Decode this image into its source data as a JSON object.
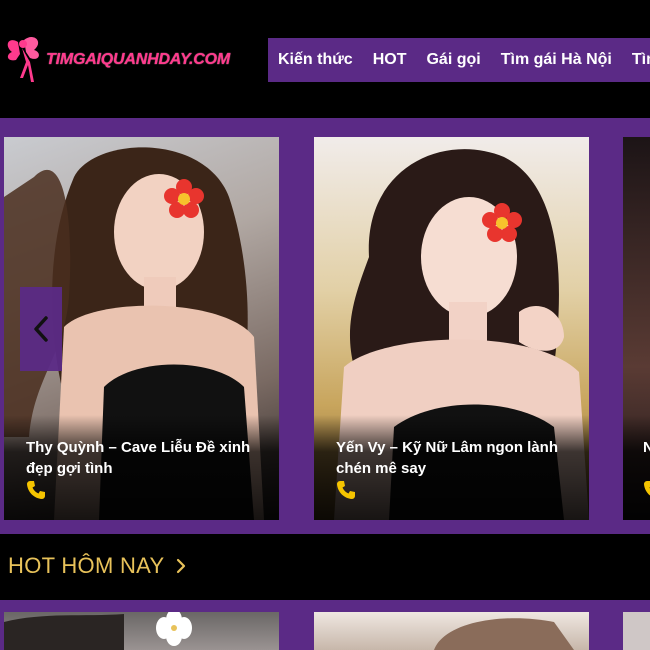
{
  "site": {
    "logo_text": "TIMGAIQUANHDAY.COM",
    "brand_pink": "#ff3a8d",
    "accent_purple": "#5b2a86",
    "heading_gold": "#e8c25a"
  },
  "nav": {
    "items": [
      {
        "label": "Kiến thức"
      },
      {
        "label": "HOT"
      },
      {
        "label": "Gái gọi"
      },
      {
        "label": "Tìm gái Hà Nội"
      },
      {
        "label": "Tìm"
      }
    ]
  },
  "featured": {
    "prev_icon": "chevron-left-icon",
    "cards": [
      {
        "title": "Thy Quỳnh – Cave Liễu Đề xinh đẹp gợi tình",
        "icon": "phone-icon"
      },
      {
        "title": "Yến Vy – Kỹ Nữ Lâm ngon lành chén mê say",
        "icon": "phone-icon"
      },
      {
        "title": "N c",
        "icon": "phone-icon"
      }
    ]
  },
  "hot_section": {
    "title": "HOT HÔM NAY",
    "icon": "chevron-right-icon"
  }
}
